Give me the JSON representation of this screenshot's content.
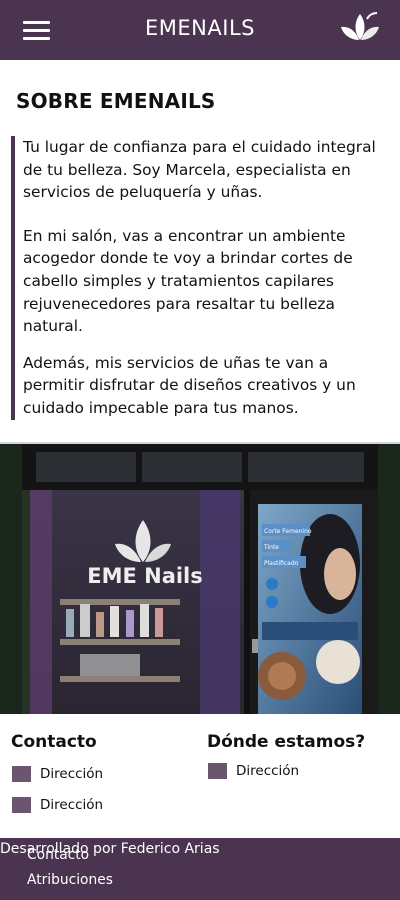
{
  "header": {
    "title": "EMENAILS",
    "menu_icon": "hamburger-menu-icon",
    "logo_icon": "lotus-logo-icon",
    "background": "#4b3450"
  },
  "about": {
    "title": "SOBRE EMENAILS",
    "paragraph_1": "Tu lugar de confianza para el cuidado integral de tu belleza. Soy Marcela, especialista en servicios de peluquería y uñas.",
    "paragraph_2": "En mi salón, vas a encontrar un ambiente acogedor donde te voy a brindar cortes de cabello simples y tratamientos capilares rejuvenecedores para resaltar tu belleza natural.",
    "paragraph_3": "Además, mis servicios de uñas te van a permitir disfrutar de diseños creativos y un cuidado impecable para tus manos.",
    "accent": "#4b3450"
  },
  "storefront": {
    "sign_text": "EME Nails",
    "poster_lines": [
      "Corte Femenino",
      "Tinte",
      "Plastificado"
    ]
  },
  "contact": {
    "heading": "Contacto",
    "items": [
      "Dirección",
      "Dirección"
    ]
  },
  "location": {
    "heading": "Dónde estamos?",
    "items": [
      "Dirección"
    ]
  },
  "footer": {
    "link_contact": "Contacto",
    "link_attributions": "Atribuciones",
    "credit": "Desarrollado por Federico Arias"
  }
}
